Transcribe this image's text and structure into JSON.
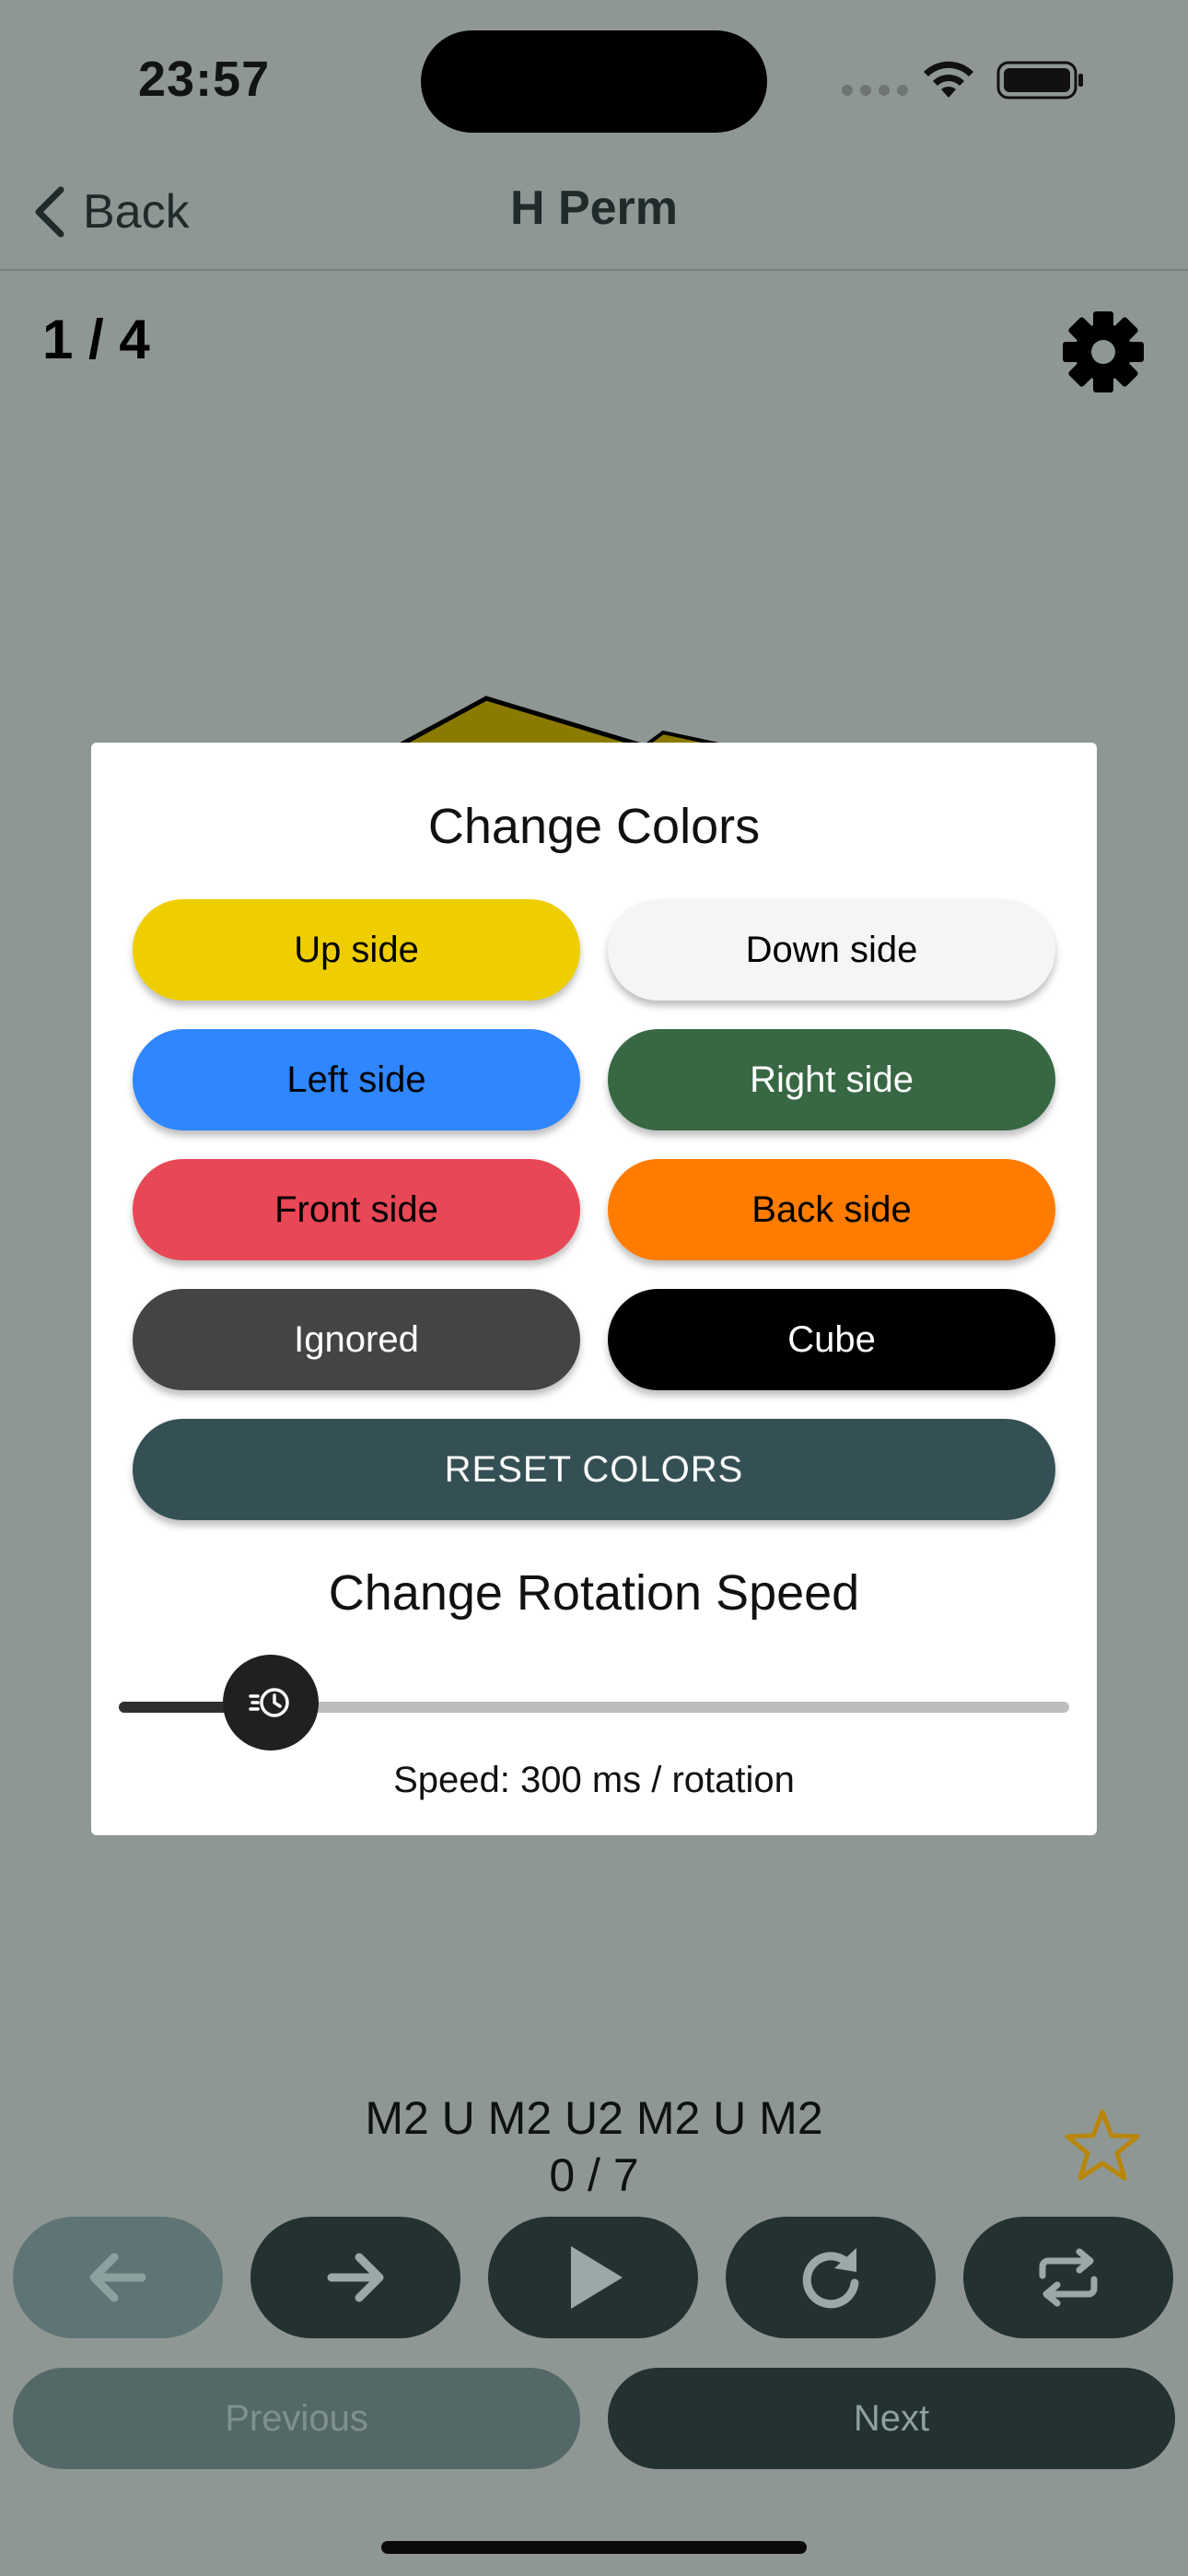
{
  "status_bar": {
    "time": "23:57",
    "icons": [
      "signal-dots-icon",
      "wifi-icon",
      "battery-icon"
    ]
  },
  "nav": {
    "back_label": "Back",
    "title": "H Perm"
  },
  "case_counter": "1 / 4",
  "modal": {
    "title": "Change Colors",
    "color_buttons": [
      {
        "label": "Up side",
        "bg": "#efce00",
        "fg": "#000000"
      },
      {
        "label": "Down side",
        "bg": "#f4f5f4",
        "fg": "#000000"
      },
      {
        "label": "Left side",
        "bg": "#2f86ff",
        "fg": "#000000"
      },
      {
        "label": "Right side",
        "bg": "#386843",
        "fg": "#ffffff"
      },
      {
        "label": "Front side",
        "bg": "#e84755",
        "fg": "#000000"
      },
      {
        "label": "Back side",
        "bg": "#ff7c00",
        "fg": "#000000"
      },
      {
        "label": "Ignored",
        "bg": "#444444",
        "fg": "#ffffff"
      },
      {
        "label": "Cube",
        "bg": "#000000",
        "fg": "#ffffff"
      }
    ],
    "reset_label": "RESET COLORS",
    "speed_title": "Change Rotation Speed",
    "speed_label": "Speed: 300 ms / rotation",
    "slider_fraction": 0.16
  },
  "algorithm": "M2 U M2 U2 M2 U M2",
  "progress": "0 / 7",
  "controls": [
    {
      "name": "step-back-button",
      "icon": "arrow-left-icon",
      "disabled": true
    },
    {
      "name": "step-forward-button",
      "icon": "arrow-right-icon",
      "disabled": false
    },
    {
      "name": "play-button",
      "icon": "play-icon",
      "disabled": false
    },
    {
      "name": "restart-button",
      "icon": "redo-icon",
      "disabled": false
    },
    {
      "name": "repeat-button",
      "icon": "repeat-icon",
      "disabled": false
    }
  ],
  "previous_label": "Previous",
  "next_label": "Next",
  "colors": {
    "backdrop": "#8f9794",
    "primary_dark": "#233131",
    "star": "#b8860b"
  }
}
